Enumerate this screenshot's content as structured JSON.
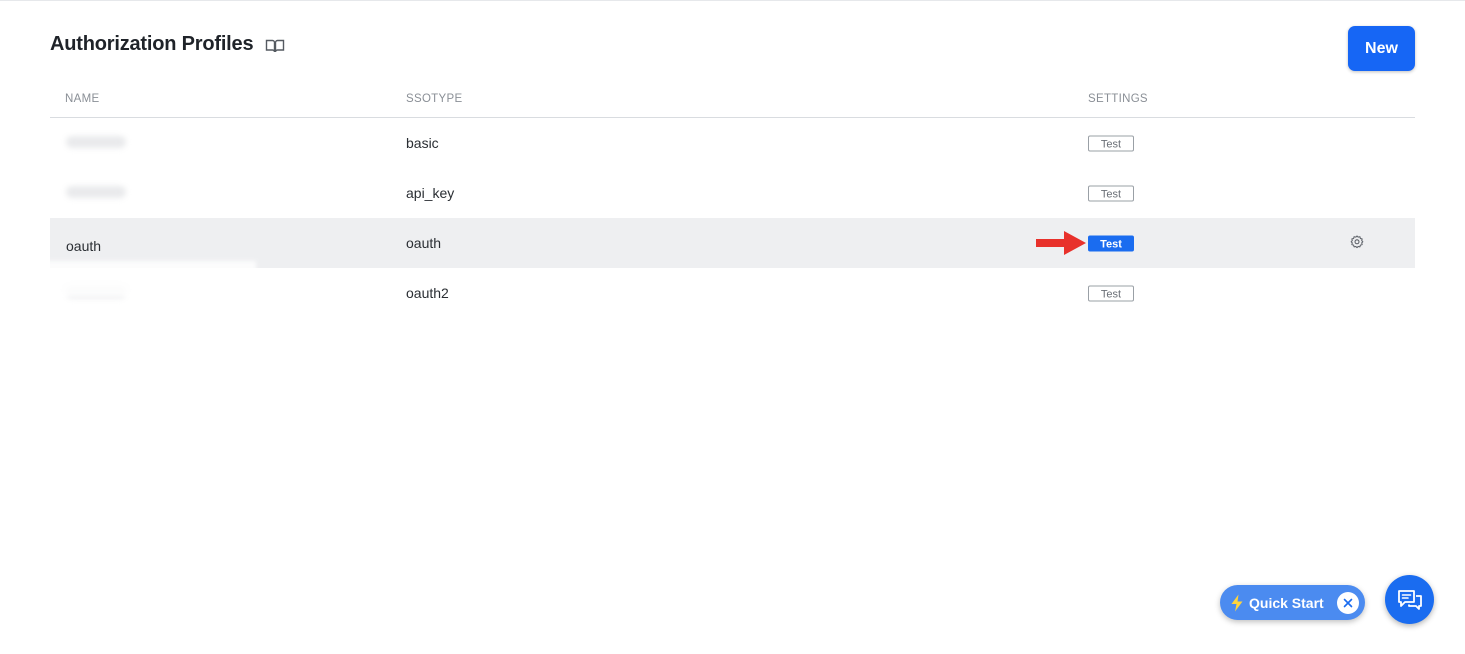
{
  "header": {
    "title": "Authorization Profiles",
    "new_button": "New"
  },
  "table": {
    "columns": [
      "NAME",
      "SSOTYPE",
      "SETTINGS"
    ],
    "rows": [
      {
        "name": "",
        "name_blurred": true,
        "ssotype": "basic",
        "test_label": "Test",
        "selected": false
      },
      {
        "name": "",
        "name_blurred": true,
        "ssotype": "api_key",
        "test_label": "Test",
        "selected": false
      },
      {
        "name": "oauth",
        "name_blurred": false,
        "ssotype": "oauth",
        "test_label": "Test",
        "selected": true
      },
      {
        "name": "",
        "name_blurred": true,
        "ssotype": "oauth2",
        "test_label": "Test",
        "selected": false
      }
    ]
  },
  "widgets": {
    "quick_start_label": "Quick Start"
  },
  "icons": {
    "docs": "book-icon",
    "row_settings": "gear-icon",
    "annotation": "red-arrow-icon",
    "quick_start": "bolt-icon",
    "chat": "chat-icon"
  },
  "colors": {
    "primary": "#1666f5",
    "selected_row": "#eeeff1",
    "annotation_arrow": "#e8312b",
    "quick_start_bg": "#4b8bf0"
  }
}
